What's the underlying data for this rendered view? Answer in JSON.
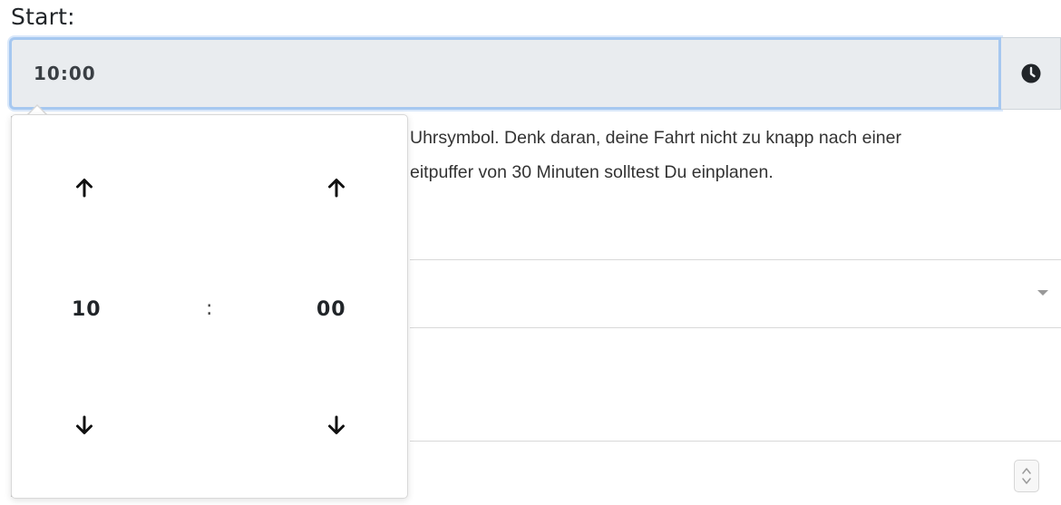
{
  "form": {
    "start_label": "Start:",
    "time_value": "10:00",
    "clock_icon": "clock-icon",
    "help_lines": [
      "Uhrsymbol. Denk daran, deine Fahrt nicht zu knapp nach einer",
      "eitpuffer von 30 Minuten solltest Du einplanen."
    ],
    "select_caret_icon": "caret-down-icon",
    "spinner_icon": "number-spinner-icon"
  },
  "timepicker": {
    "hours": "10",
    "separator": ":",
    "minutes": "00",
    "increment_icon": "arrow-up-icon",
    "decrement_icon": "arrow-down-icon"
  },
  "colors": {
    "input_bg": "#e9ecef",
    "focus_border": "#a6c8f0",
    "text": "#212529"
  }
}
